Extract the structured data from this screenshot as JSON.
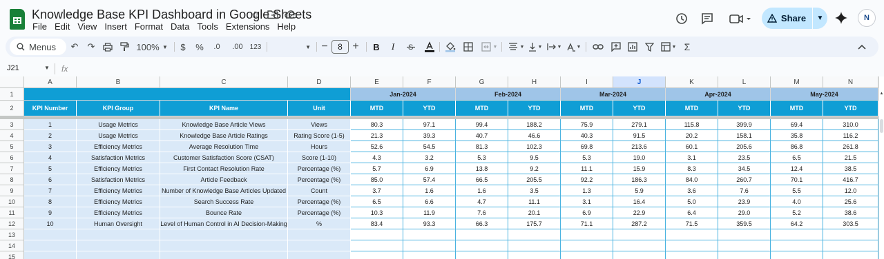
{
  "doc": {
    "title": "Knowledge Base KPI Dashboard in Google Sheets"
  },
  "menu": [
    "File",
    "Edit",
    "View",
    "Insert",
    "Format",
    "Data",
    "Tools",
    "Extensions",
    "Help"
  ],
  "actions": {
    "share_label": "Share",
    "avatar_initials": "N"
  },
  "toolbar": {
    "menus_label": "Menus",
    "zoom": "100%",
    "currency": "$",
    "percent": "%",
    "dec_less": ".0",
    "dec_more": ".00",
    "number_format": "123",
    "font_size": "8",
    "bold": "B",
    "italic": "I",
    "sigma": "Σ"
  },
  "formula_bar": {
    "name_box": "J21",
    "fx": "fx"
  },
  "grid": {
    "columns": [
      "A",
      "B",
      "C",
      "D",
      "E",
      "F",
      "G",
      "H",
      "I",
      "J",
      "K",
      "L",
      "M",
      "N"
    ],
    "selected_column": "J",
    "row_numbers": [
      "1",
      "2",
      "3",
      "4",
      "5",
      "6",
      "7",
      "8",
      "9",
      "10",
      "11",
      "12",
      "13",
      "14",
      "15"
    ],
    "months": [
      "Jan-2024",
      "Feb-2024",
      "Mar-2024",
      "Apr-2024",
      "May-2024"
    ],
    "header": [
      "KPI Number",
      "KPI Group",
      "KPI Name",
      "Unit"
    ],
    "sub_header": [
      "MTD",
      "YTD"
    ],
    "rows": [
      [
        "1",
        "Usage Metrics",
        "Knowledge Base Article Views",
        "Views",
        "80.3",
        "97.1",
        "99.4",
        "188.2",
        "75.9",
        "279.1",
        "115.8",
        "399.9",
        "69.4",
        "310.0"
      ],
      [
        "2",
        "Usage Metrics",
        "Knowledge Base Article Ratings",
        "Rating Score (1-5)",
        "21.3",
        "39.3",
        "40.7",
        "46.6",
        "40.3",
        "91.5",
        "20.2",
        "158.1",
        "35.8",
        "116.2"
      ],
      [
        "3",
        "Efficiency Metrics",
        "Average Resolution Time",
        "Hours",
        "52.6",
        "54.5",
        "81.3",
        "102.3",
        "69.8",
        "213.6",
        "60.1",
        "205.6",
        "86.8",
        "261.8"
      ],
      [
        "4",
        "Satisfaction Metrics",
        "Customer Satisfaction Score (CSAT)",
        "Score (1-10)",
        "4.3",
        "3.2",
        "5.3",
        "9.5",
        "5.3",
        "19.0",
        "3.1",
        "23.5",
        "6.5",
        "21.5"
      ],
      [
        "5",
        "Efficiency Metrics",
        "First Contact Resolution Rate",
        "Percentage (%)",
        "5.7",
        "6.9",
        "13.8",
        "9.2",
        "11.1",
        "15.9",
        "8.3",
        "34.5",
        "12.4",
        "38.5"
      ],
      [
        "6",
        "Satisfaction Metrics",
        "Article Feedback",
        "Percentage (%)",
        "85.0",
        "57.4",
        "66.5",
        "205.5",
        "92.2",
        "186.3",
        "84.0",
        "260.7",
        "70.1",
        "416.7"
      ],
      [
        "7",
        "Efficiency Metrics",
        "Number of Knowledge Base Articles Updated",
        "Count",
        "3.7",
        "1.6",
        "1.6",
        "3.5",
        "1.3",
        "5.9",
        "3.6",
        "7.6",
        "5.5",
        "12.0"
      ],
      [
        "8",
        "Efficiency Metrics",
        "Search Success Rate",
        "Percentage (%)",
        "6.5",
        "6.6",
        "4.7",
        "11.1",
        "3.1",
        "16.4",
        "5.0",
        "23.9",
        "4.0",
        "25.6"
      ],
      [
        "9",
        "Efficiency Metrics",
        "Bounce Rate",
        "Percentage (%)",
        "10.3",
        "11.9",
        "7.6",
        "20.1",
        "6.9",
        "22.9",
        "6.4",
        "29.0",
        "5.2",
        "38.6"
      ],
      [
        "10",
        "Human Oversight",
        "Level of Human Control in AI Decision-Making",
        "%",
        "83.4",
        "93.3",
        "66.3",
        "175.7",
        "71.1",
        "287.2",
        "71.5",
        "359.5",
        "64.2",
        "303.5"
      ]
    ]
  },
  "colors": {
    "header_blue": "#0f9ed5",
    "month_blue": "#9fc5e8",
    "left_fill": "#dae9f8",
    "share_bg": "#c2e7ff"
  }
}
